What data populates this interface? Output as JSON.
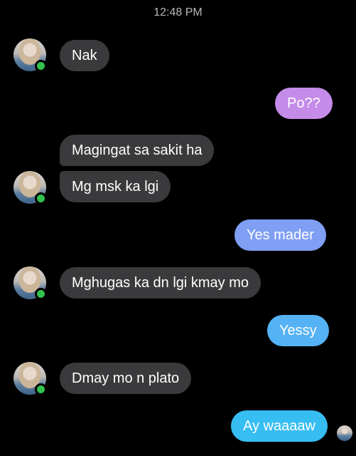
{
  "status": {
    "time": "12:48 PM"
  },
  "messages": [
    {
      "from": "contact",
      "text": "Nak"
    },
    {
      "from": "me",
      "text": "Po??"
    },
    {
      "from": "contact",
      "text": "Magingat sa sakit ha"
    },
    {
      "from": "contact",
      "text": "Mg msk ka lgi"
    },
    {
      "from": "me",
      "text": "Yes mader"
    },
    {
      "from": "contact",
      "text": "Mghugas ka dn lgi kmay mo"
    },
    {
      "from": "me",
      "text": "Yessy"
    },
    {
      "from": "contact",
      "text": "Dmay mo n plato"
    },
    {
      "from": "me",
      "text": "Ay waaaaw"
    }
  ],
  "colors": {
    "incoming_bubble": "#3a3a3c",
    "outgoing_gradient": [
      "#c48be8",
      "#7f9ef4",
      "#55b2f5",
      "#36bdf2"
    ],
    "online_indicator": "#31c24d"
  }
}
